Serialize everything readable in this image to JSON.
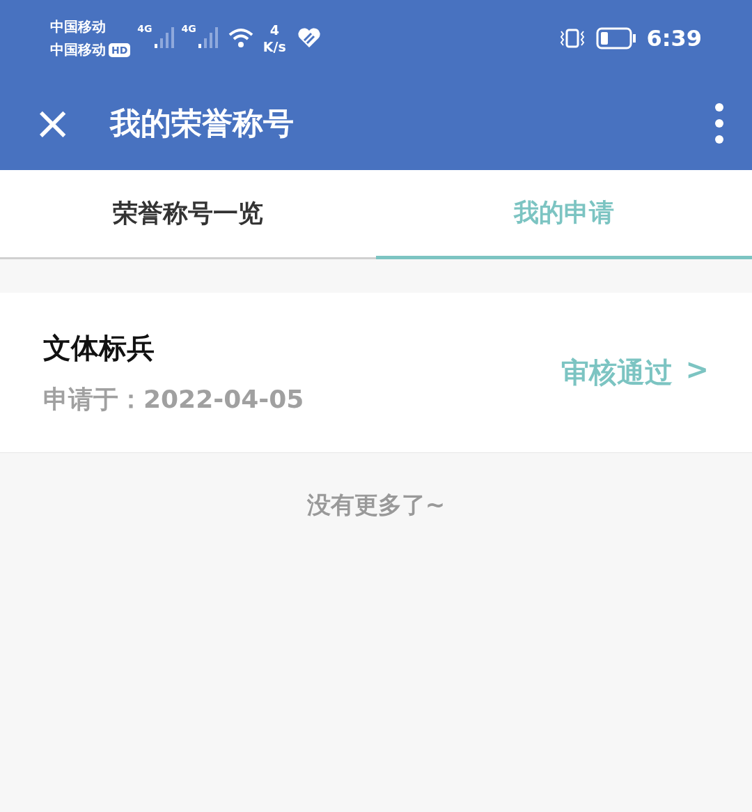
{
  "status_bar": {
    "carriers": [
      "中国移动",
      "中国移动"
    ],
    "hd_badge": "HD",
    "network": [
      "4G",
      "4G"
    ],
    "speed": {
      "value": "4",
      "unit": "K/s"
    },
    "time": "6:39"
  },
  "toolbar": {
    "close": "×",
    "title": "我的荣誉称号"
  },
  "tabs": [
    {
      "label": "荣誉称号一览",
      "selected": false
    },
    {
      "label": "我的申请",
      "selected": true
    }
  ],
  "applications": [
    {
      "title": "文体标兵",
      "applied": "申请于：2022-04-05",
      "status": "审核通过",
      "arrow": ">"
    }
  ],
  "footer": "没有更多了~"
}
